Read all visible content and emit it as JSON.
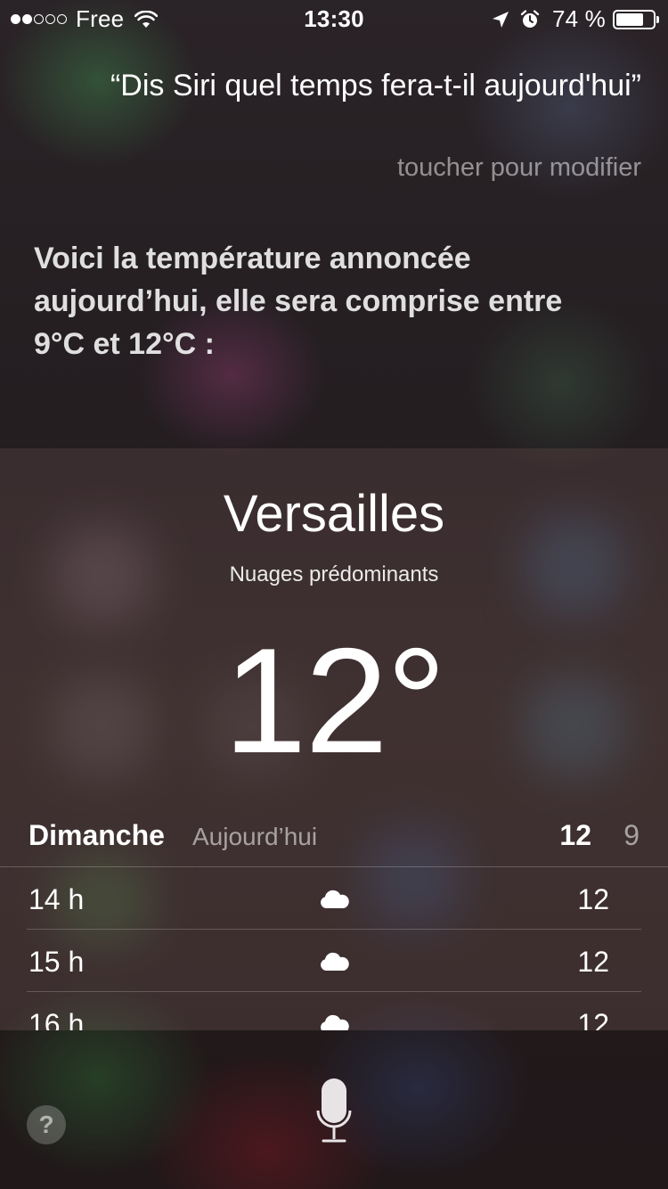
{
  "status_bar": {
    "signal_dots": [
      "full",
      "full",
      "empty",
      "empty",
      "empty"
    ],
    "carrier": "Free",
    "time": "13:30",
    "battery_percent": "74 %",
    "battery_level": 0.74,
    "icons": [
      "wifi-icon",
      "location-arrow-icon",
      "alarm-icon",
      "battery-icon"
    ]
  },
  "query": {
    "text": "“Dis Siri quel temps fera-t-il aujourd'hui”",
    "edit_hint": "toucher pour modifier"
  },
  "answer": {
    "text": "Voici la température annoncée aujourd’hui, elle sera comprise entre 9°C et 12°C :"
  },
  "weather": {
    "city": "Versailles",
    "condition": "Nuages prédominants",
    "current_temp": "12°",
    "day": {
      "name": "Dimanche",
      "sub": "Aujourd’hui",
      "high": "12",
      "low": "9"
    },
    "hourly": [
      {
        "time": "14 h",
        "icon": "cloud-icon",
        "temp": "12"
      },
      {
        "time": "15 h",
        "icon": "cloud-icon",
        "temp": "12"
      },
      {
        "time": "16 h",
        "icon": "cloud-icon",
        "temp": "12"
      }
    ]
  },
  "bottom": {
    "help_label": "?",
    "icons": [
      "help-icon",
      "microphone-icon"
    ]
  }
}
